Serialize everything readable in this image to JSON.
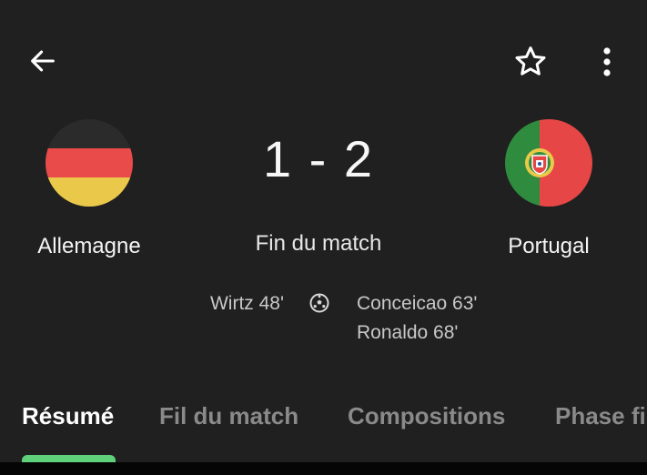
{
  "header": {
    "back_icon": "arrow-left-icon",
    "favorite_icon": "star-outline-icon",
    "more_icon": "more-vertical-icon"
  },
  "match": {
    "home": {
      "name": "Allemagne",
      "flag_colors": [
        "#2b2b2b",
        "#e94a4a",
        "#e9c84a"
      ]
    },
    "away": {
      "name": "Portugal",
      "flag_colors": [
        "#2f8c3e",
        "#e64646"
      ]
    },
    "score": "1 - 2",
    "status": "Fin du match"
  },
  "goals": {
    "home": [
      "Wirtz 48'"
    ],
    "away": [
      "Conceicao 63'",
      "Ronaldo 68'"
    ],
    "icon": "soccer-ball-icon"
  },
  "tabs": [
    {
      "label": "Résumé",
      "active": true
    },
    {
      "label": "Fil du match",
      "active": false
    },
    {
      "label": "Compositions",
      "active": false
    },
    {
      "label": "Phase fi",
      "active": false
    }
  ],
  "colors": {
    "background": "#202020",
    "accent": "#5fd17a",
    "tab_inactive": "#8a8a8a"
  }
}
